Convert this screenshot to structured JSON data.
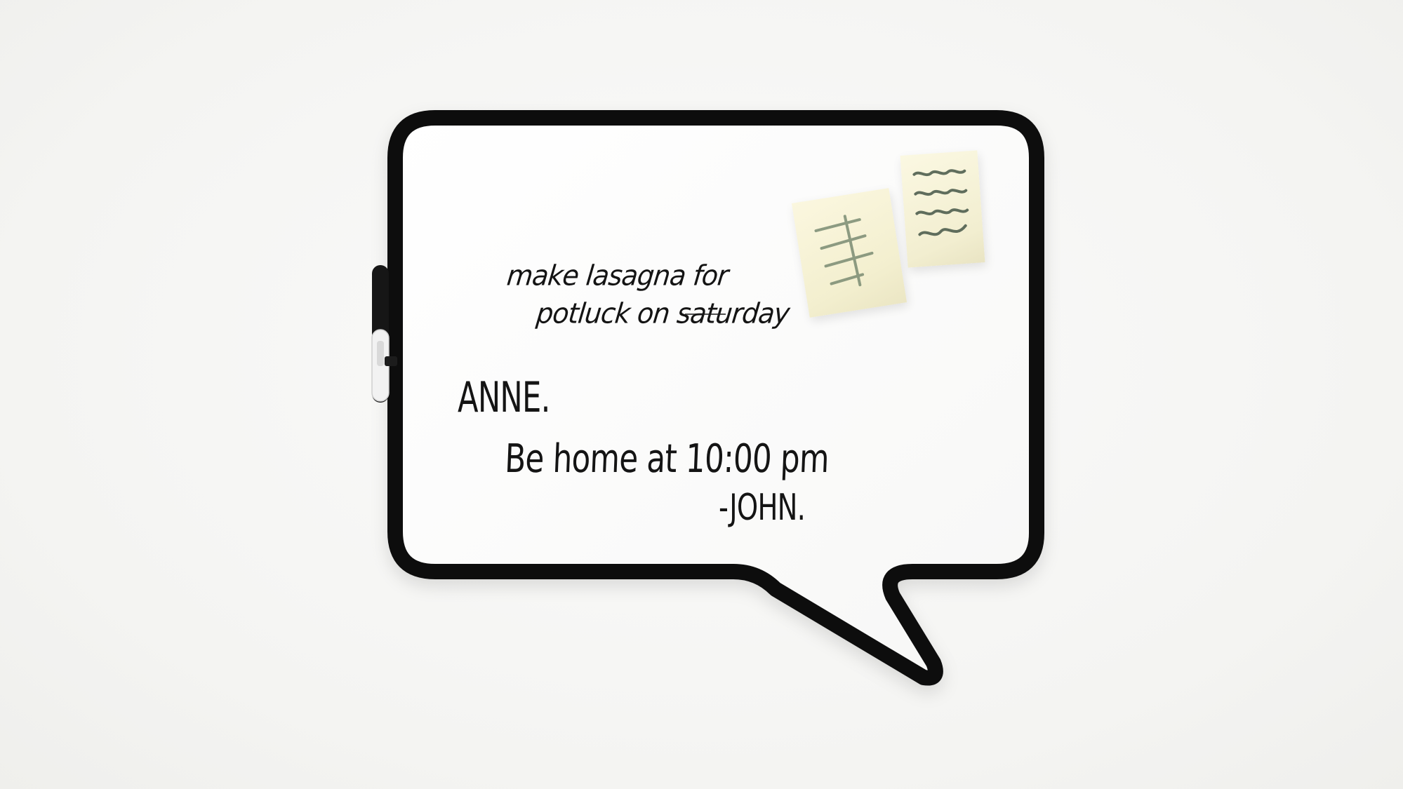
{
  "scene": {
    "background_color": "#f6f6f4",
    "board_frame_color": "#111111",
    "board_surface_color": "#ffffff",
    "sticky_note_color": "#f6f1d3"
  },
  "whiteboard": {
    "notes": {
      "line1": "make lasagna for",
      "line2": "potluck on saturday",
      "line3": "ANNE.",
      "line4": "Be home at 10:00 pm",
      "line5": "-JOHN."
    }
  },
  "icons": {
    "marker": "marker-icon",
    "sticky_notes": "sticky-note-icon"
  }
}
